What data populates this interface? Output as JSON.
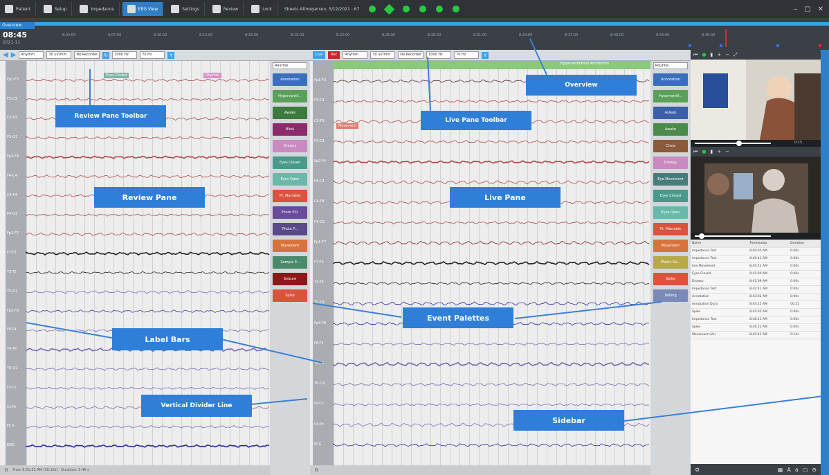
{
  "topbar": {
    "buttons": [
      {
        "label": "Patient",
        "icon": "person-icon"
      },
      {
        "label": "Setup",
        "icon": "setup-icon"
      },
      {
        "label": "Impedance",
        "icon": "impedance-icon"
      },
      {
        "label": "EEG View",
        "icon": "eeg-icon",
        "active": true
      },
      {
        "label": "Settings",
        "icon": "gear-icon"
      },
      {
        "label": "Review",
        "icon": "review-icon"
      },
      {
        "label": "Lock",
        "icon": "lock-icon"
      }
    ],
    "title": "Sheets Altmeyerson, 5/12/2021 - 67",
    "window_controls": [
      "–",
      "▢",
      "✕"
    ]
  },
  "overview": {
    "tab_label": "Overview",
    "time": "08:45",
    "date": "2021-11",
    "ticks": [
      "8:04:00",
      "8:07:00",
      "8:10:00",
      "8:13:00",
      "8:16:00",
      "8:19:00",
      "8:22:00",
      "8:25:00",
      "8:28:00",
      "8:31:00",
      "8:34:00",
      "8:37:00",
      "8:40:00",
      "8:43:00",
      "8:46:00"
    ]
  },
  "review_toolbar": {
    "montage": "Rhythm",
    "sensitivity": "30 uV/mm",
    "timebase": "No Recorder",
    "filter": "1000 Hz",
    "notch": "70 Hz"
  },
  "live_toolbar": {
    "mode_label": "Live",
    "record_label": "Rec",
    "montage": "Rhythm",
    "sensitivity": "30 uV/mm",
    "timebase": "No Recorder",
    "filter": "1000 Hz",
    "notch": "70 Hz"
  },
  "review_labels": [
    "Fp1-F3",
    "F3-C3",
    "C3-P3",
    "P3-O1",
    "Fp2-F4",
    "F4-C4",
    "C4-P4",
    "P4-O2",
    "Fp1-F7",
    "F7-T3",
    "T3-T5",
    "T5-O1",
    "Fp2-F8",
    "F8-T4",
    "T4-T6",
    "T6-O2",
    "Fz-Cz",
    "Cz-Pz",
    "ECG",
    "EMG"
  ],
  "live_labels": [
    "Fp1-F3",
    "F3-C3",
    "C3-P3",
    "P3-O1",
    "Fp2-F4",
    "F4-C4",
    "C4-P4",
    "P4-O2",
    "Fp1-F7",
    "F7-T3",
    "T3-T5",
    "T5-O1",
    "Fp2-F8",
    "F8-T4",
    "T4-T6",
    "T6-O2",
    "Fz-Cz",
    "Cz-Pz",
    "ECG"
  ],
  "review_tags": [
    {
      "label": "Eyes Closed",
      "color": "#7fb3a8"
    },
    {
      "label": "Rhythm",
      "color": "#d98fc8"
    }
  ],
  "live_tags": [
    {
      "label": "Hyperventilation Annotation",
      "color": "#8ac87a"
    },
    {
      "label": "Movement",
      "color": "#e07a6a"
    }
  ],
  "review_palette": {
    "select": "Routine",
    "buttons": [
      {
        "label": "Annotation",
        "color": "#3b6fbe"
      },
      {
        "label": "Hyperventil...",
        "color": "#5aa05a"
      },
      {
        "label": "Awake",
        "color": "#3d7a3d"
      },
      {
        "label": "Blink",
        "color": "#8c2a6a"
      },
      {
        "label": "Drowsy",
        "color": "#c98ac0"
      },
      {
        "label": "Eyes Closed",
        "color": "#4a9a8a"
      },
      {
        "label": "Eyes Open",
        "color": "#6ab8a8"
      },
      {
        "label": "Pt. Marrable",
        "color": "#d9533d"
      },
      {
        "label": "Photo P.O.",
        "color": "#6a4a9a"
      },
      {
        "label": "Photo P...",
        "color": "#5a4a8a"
      },
      {
        "label": "Movement",
        "color": "#d9733d"
      },
      {
        "label": "Sample P...",
        "color": "#4a8a6a"
      },
      {
        "label": "Seizure",
        "color": "#8a1a1a"
      },
      {
        "label": "Spike",
        "color": "#d9533d"
      }
    ]
  },
  "live_palette": {
    "select": "Routine",
    "buttons": [
      {
        "label": "Annotation",
        "color": "#3b6fbe"
      },
      {
        "label": "Hyperventil...",
        "color": "#5aa05a"
      },
      {
        "label": "Asleep",
        "color": "#3b5fa8"
      },
      {
        "label": "Awake",
        "color": "#4a8a4a"
      },
      {
        "label": "Chew",
        "color": "#8a5a3a"
      },
      {
        "label": "Drowsy",
        "color": "#c98ac0"
      },
      {
        "label": "Eye Movement",
        "color": "#4a7a7a"
      },
      {
        "label": "Eyes Closed",
        "color": "#4a9a8a"
      },
      {
        "label": "Eyes Open",
        "color": "#6ab8a8"
      },
      {
        "label": "Pt. Marrable",
        "color": "#d9533d"
      },
      {
        "label": "Movement",
        "color": "#d9733d"
      },
      {
        "label": "Photic Sti...",
        "color": "#b8a84a"
      },
      {
        "label": "Spike",
        "color": "#d9533d"
      },
      {
        "label": "Talking",
        "color": "#7a8ab8"
      }
    ]
  },
  "sidebar": {
    "video_time": "0:15",
    "table_headers": [
      "Name",
      "Timestamp",
      "Duration"
    ],
    "events": [
      [
        "Impedance Test",
        "8:00:05 AM",
        "0:00s"
      ],
      [
        "Impedance Test",
        "8:40:41 AM",
        "0:00s"
      ],
      [
        "Eye Movement",
        "8:40:51 AM",
        "0:00s"
      ],
      [
        "Eyes Closed",
        "8:41:00 AM",
        "0:00s"
      ],
      [
        "Drowsy",
        "8:41:09 AM",
        "0:00s"
      ],
      [
        "Impedance Test",
        "8:42:41 AM",
        "0:00s"
      ],
      [
        "Annotation",
        "8:43:02 AM",
        "0:00s"
      ],
      [
        "Annotation Dura",
        "8:44:15 AM",
        "00:21"
      ],
      [
        "Spike",
        "8:45:05 AM",
        "0:00s"
      ],
      [
        "Impedance Test",
        "8:46:21 AM",
        "0:00s"
      ],
      [
        "Spike",
        "8:46:21 AM",
        "0:00s"
      ],
      [
        "Movement (Ve)",
        "8:45:41 AM",
        "0:14s"
      ]
    ]
  },
  "review_footer": "From 8:01:31 AM (00:16s) · Duration: 5:46 s",
  "callouts": {
    "overview": "Overview",
    "review_toolbar": "Review Pane Toolbar",
    "live_toolbar": "Live Pane Toolbar",
    "review_pane": "Review Pane",
    "live_pane": "Live Pane",
    "event_palettes": "Event Palettes",
    "label_bars": "Label Bars",
    "vertical_divider": "Vertical Divider Line",
    "sidebar": "Sidebar"
  }
}
